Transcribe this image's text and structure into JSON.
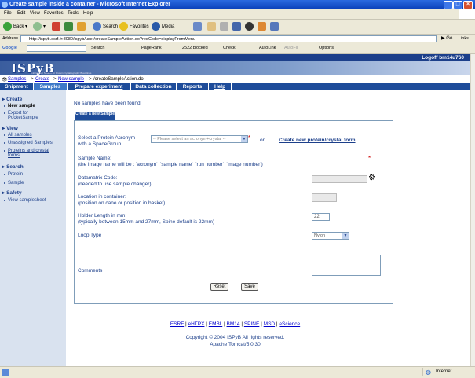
{
  "window": {
    "title": "Create sample inside a container - Microsoft Internet Explorer"
  },
  "menu": [
    "File",
    "Edit",
    "View",
    "Favorites",
    "Tools",
    "Help"
  ],
  "toolbar": {
    "back": "Back",
    "search": "Search",
    "favorites": "Favorites",
    "media": "Media"
  },
  "address": {
    "label": "Address",
    "url": "http://ispyb.esrf.fr:8080/ispyb/user/createSampleAction.do?reqCode=displayFromMenu",
    "go": "Go",
    "links": "Links"
  },
  "googlebar": {
    "label": "Google",
    "search": "Search",
    "pagerank": "PageRank",
    "blocked": "2522 blocked",
    "check": "Check",
    "autolink": "AutoLink",
    "autofill": "AutoFill",
    "options": "Options"
  },
  "header": {
    "logoff": "Logoff bm14u760",
    "logo": "ISPyB",
    "logo_sub": "Information System for Protein crystallography Beamlines"
  },
  "breadcrumb": {
    "samples": "Samples",
    "create": "Create",
    "new_sample": "New sample",
    "action": "/createSampleAction.do"
  },
  "nav": [
    "Shipment",
    "Samples",
    "Prepare experiment",
    "Data collection",
    "Reports",
    "Help"
  ],
  "sidebar": {
    "create": "Create",
    "new_sample": "New sample",
    "export1": "Export for",
    "export2": "PocketSample",
    "view": "View",
    "all_samples": "All samples",
    "unassigned": "Unassigned Samples",
    "proteins1": "Proteins and crystal",
    "proteins2": "forms",
    "search": "Search",
    "protein": "Protein",
    "sample": "Sample",
    "safety": "Safety",
    "samplesheet": "View samplesheet"
  },
  "main": {
    "message": "No samples have been found",
    "form_tab": "Create a new Sample",
    "acronym_label1": "Select a Protein Acronym",
    "acronym_label2": "with a SpaceGroup",
    "acronym_placeholder": "-- Please select an acronym+crystal --",
    "or": "or",
    "create_protein_link": "Create new protein/crystal form",
    "sample_name_label1": "Sample Name:",
    "sample_name_label2": "(the image name will be : 'acronym'_'sample name'_'run number'_'image number')",
    "datamatrix_label1": "Datamatrix Code:",
    "datamatrix_label2": " (needed to use sample changer)",
    "location_label1": "Location in container:",
    "location_label2": "(position on cane or position in basket)",
    "holder_label1": "Holder Length in mm:",
    "holder_label2": "(typically between 15mm and 27mm, Spine default is 22mm)",
    "holder_value": "22",
    "loop_label": "Loop Type",
    "loop_value": "Nylon",
    "comments_label": "Comments",
    "reset": "Reset",
    "save": "Save"
  },
  "footer": {
    "links": [
      "ESRF",
      "eHTPX",
      "EMBL",
      "BM14",
      "SPINE",
      "MSD",
      "eScience"
    ],
    "copyright": "Copyright © 2004 ISPyB All rights reserved.",
    "server": "Apache Tomcat/5.0.30"
  },
  "status": {
    "zone": "Internet"
  }
}
